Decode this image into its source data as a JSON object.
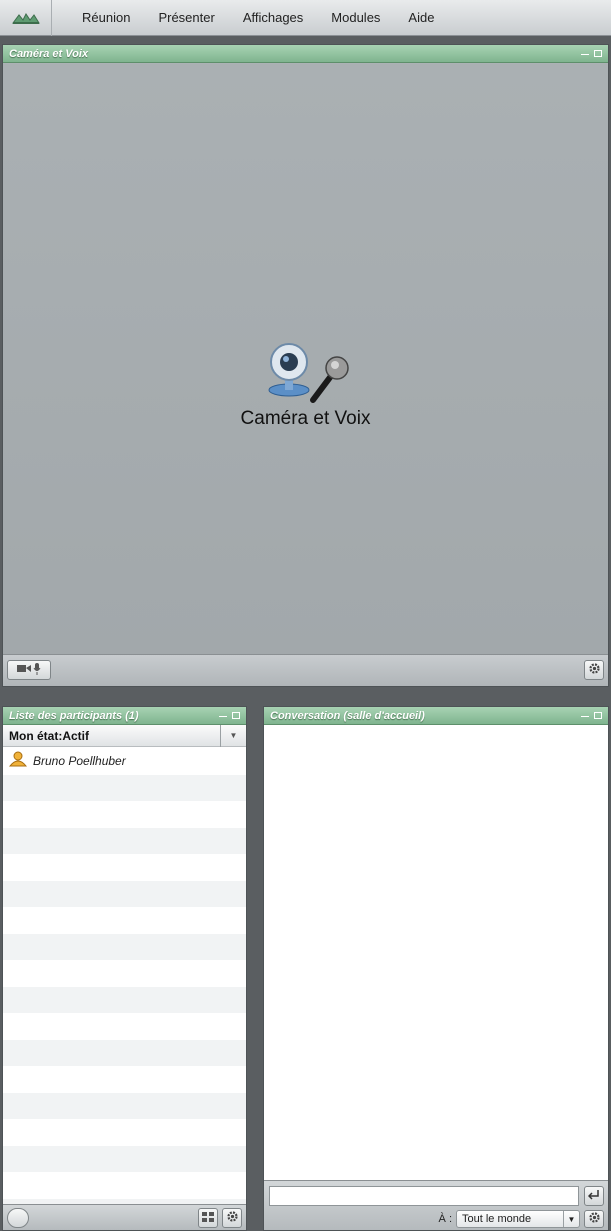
{
  "menu": {
    "items": [
      {
        "label": "Réunion"
      },
      {
        "label": "Présenter"
      },
      {
        "label": "Affichages"
      },
      {
        "label": "Modules"
      },
      {
        "label": "Aide"
      }
    ]
  },
  "camera_panel": {
    "title": "Caméra et Voix",
    "center_label": "Caméra et Voix"
  },
  "users_panel": {
    "title": "Liste des participants (1)",
    "status_label": "Mon état:Actif",
    "participants": [
      {
        "name": "Bruno Poellhuber"
      }
    ]
  },
  "chat_panel": {
    "title": "Conversation (salle d'accueil)",
    "input_value": "",
    "to_label": "À :",
    "to_value": "Tout le monde"
  },
  "colors": {
    "title_bar": "#8cc29b",
    "panel_bg": "#aab0b3",
    "menubar": "#d9dcde"
  }
}
